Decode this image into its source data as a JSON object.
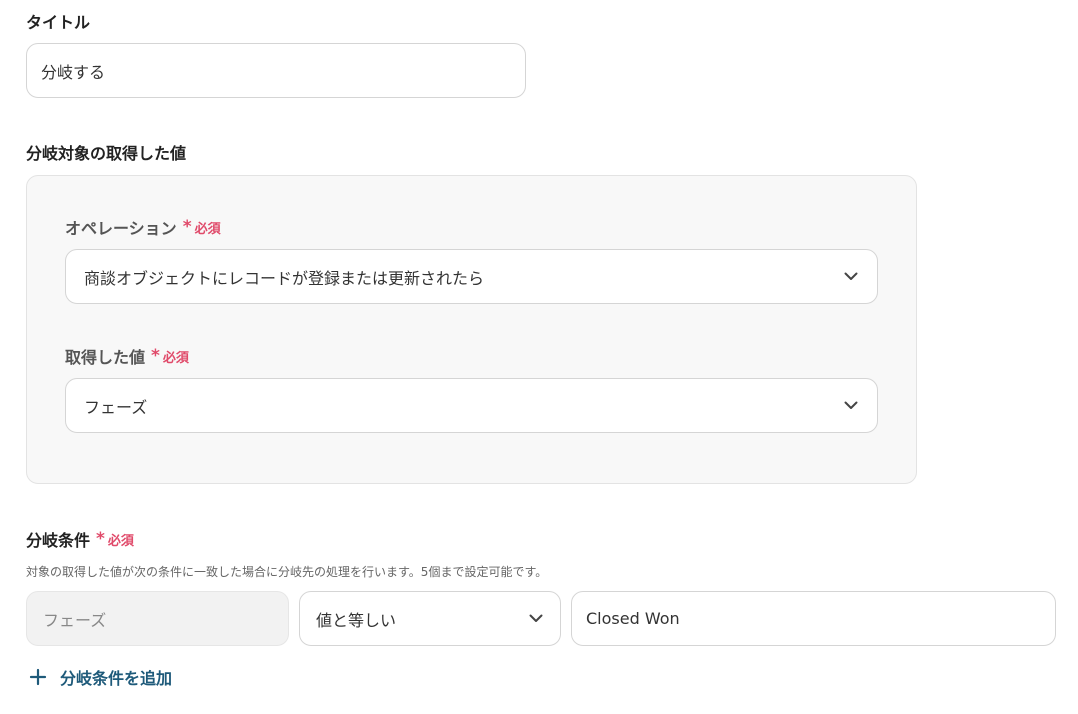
{
  "title_section": {
    "label": "タイトル",
    "value": "分岐する"
  },
  "target_section": {
    "label": "分岐対象の取得した値",
    "operation": {
      "label": "オペレーション",
      "required_mark": "*",
      "required_text": "必須",
      "selected": "商談オブジェクトにレコードが登録または更新されたら"
    },
    "acquired_value": {
      "label": "取得した値",
      "required_mark": "*",
      "required_text": "必須",
      "selected": "フェーズ"
    }
  },
  "condition_section": {
    "label": "分岐条件",
    "required_mark": "*",
    "required_text": "必須",
    "help": "対象の取得した値が次の条件に一致した場合に分岐先の処理を行います。5個まで設定可能です。",
    "field": "フェーズ",
    "operator": "値と等しい",
    "value": "Closed Won",
    "add_label": "分岐条件を追加"
  },
  "colors": {
    "required": "#e04a6a",
    "link": "#1e5a7a"
  }
}
